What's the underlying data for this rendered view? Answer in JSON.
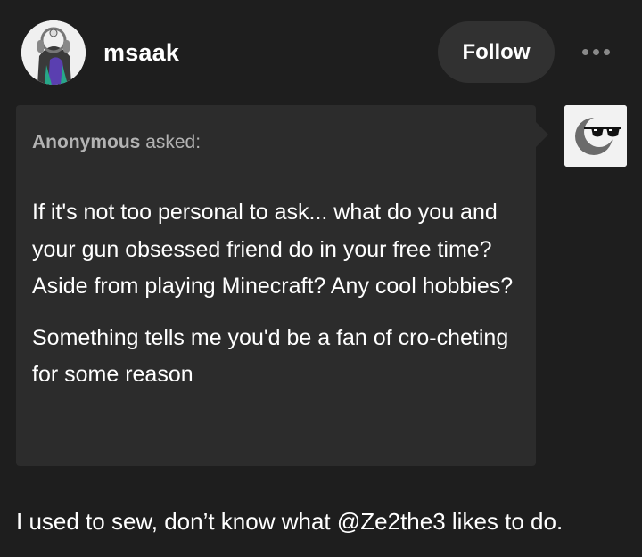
{
  "header": {
    "username": "msaak",
    "follow_label": "Follow"
  },
  "ask": {
    "asker": "Anonymous",
    "asked_label": "asked:",
    "question_paragraphs": [
      "If it's not too personal to ask... what do you and your gun obsessed friend do in your free time? Aside from playing Minecraft? Any cool hobbies?",
      "Something tells me you'd be a fan of cro-cheting for some reason"
    ]
  },
  "answer": {
    "text": "I used to sew, don’t know what @Ze2the3 likes to do."
  },
  "colors": {
    "background": "#1e1e1e",
    "bubble": "#2c2c2c",
    "follow_button": "#313131",
    "muted_text": "#b3b3b3"
  },
  "icons": {
    "more": "ellipsis-icon",
    "anon_avatar": "sunglasses-moon-icon"
  }
}
